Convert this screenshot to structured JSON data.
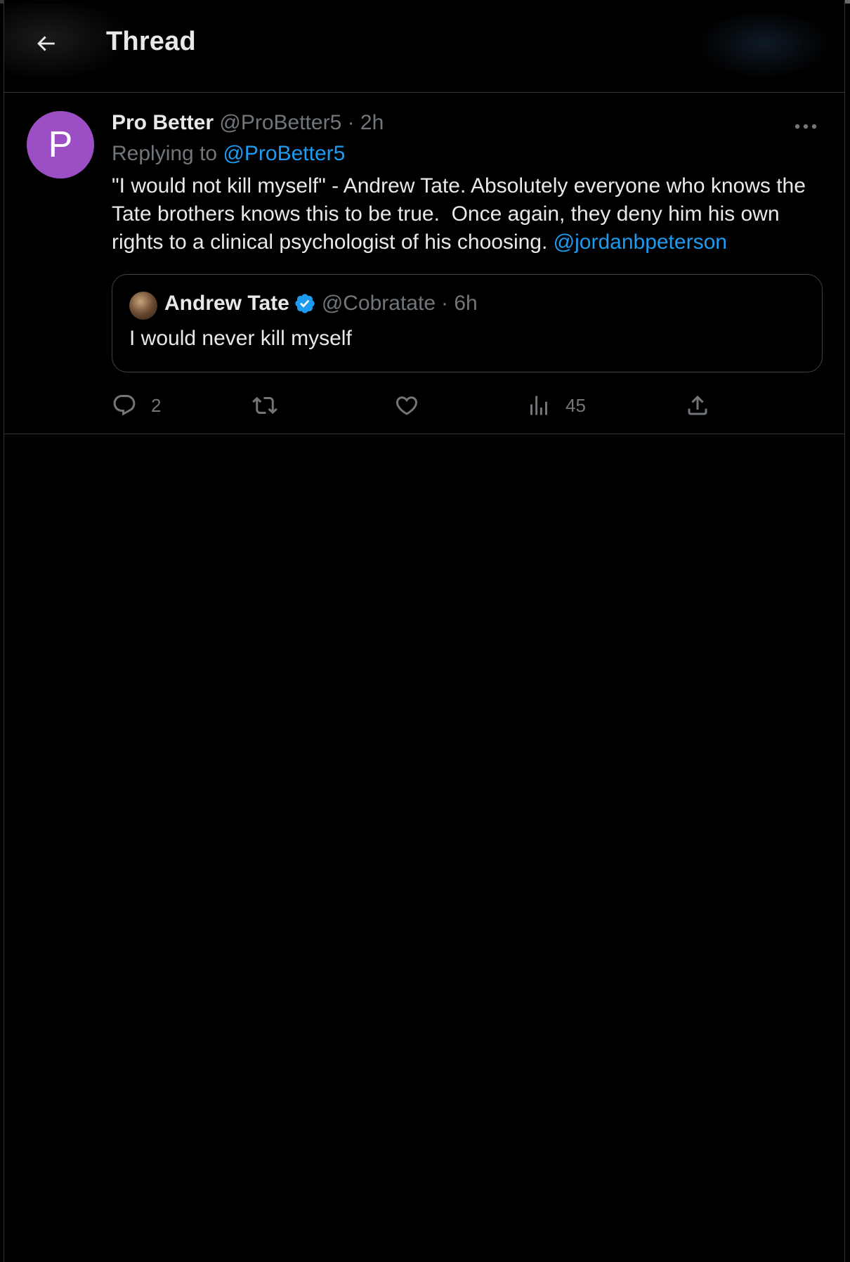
{
  "header": {
    "title": "Thread"
  },
  "tweet": {
    "avatar_letter": "P",
    "avatar_color": "#9c4fc5",
    "author_name": "Pro Better",
    "author_handle": "@ProBetter5",
    "time": "· 2h",
    "replying_label": "Replying to ",
    "replying_handle": "@ProBetter5",
    "text": "\"I would not kill myself\" - Andrew Tate. Absolutely everyone who knows the Tate brothers knows this to be true.  Once again, they deny him his own rights to a clinical psychologist of his choosing. ",
    "mention": "@jordanbpeterson",
    "quote": {
      "author_name": "Andrew Tate",
      "author_handle": "@Cobratate",
      "time": "· 6h",
      "text": "I would never kill myself",
      "verified": true
    },
    "actions": {
      "reply_count": "2",
      "retweet_count": "",
      "like_count": "",
      "views_count": "45"
    }
  },
  "colors": {
    "background": "#000000",
    "text": "#e7e9ea",
    "muted": "#71767b",
    "link": "#1d9bf0",
    "border": "#2f3336"
  }
}
